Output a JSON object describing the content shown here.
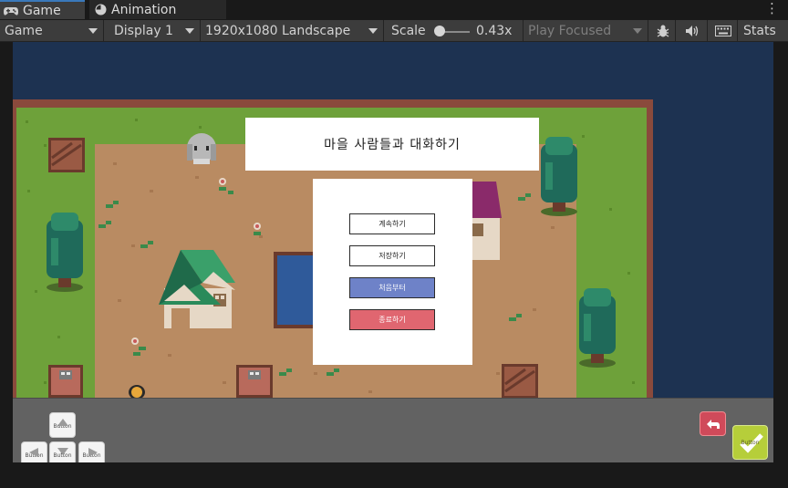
{
  "tabs": {
    "game": "Game",
    "animation": "Animation"
  },
  "toolbar": {
    "game_view": "Game",
    "display": "Display 1",
    "resolution": "1920x1080 Landscape",
    "scale_label": "Scale",
    "scale_value": "0.43x",
    "play_mode": "Play Focused",
    "stats": "Stats"
  },
  "dialog": {
    "title": "마을 사람들과 대화하기",
    "continue": "계속하기",
    "save": "저장하기",
    "new_game": "처음부터",
    "quit": "종료하기"
  },
  "controls": {
    "up": "Button",
    "left": "Button",
    "down": "Button",
    "right": "Button",
    "confirm": "Button"
  },
  "colors": {
    "unity_dark": "#191919",
    "toolbar": "#3c3c3c",
    "game_background": "#1d3251",
    "grass": "#6ea13a",
    "dirt": "#b98b62",
    "new_game_button": "#6e82c8",
    "quit_button": "#e06670",
    "confirm_button": "#b6ce3a",
    "back_button": "#d04a5a"
  }
}
